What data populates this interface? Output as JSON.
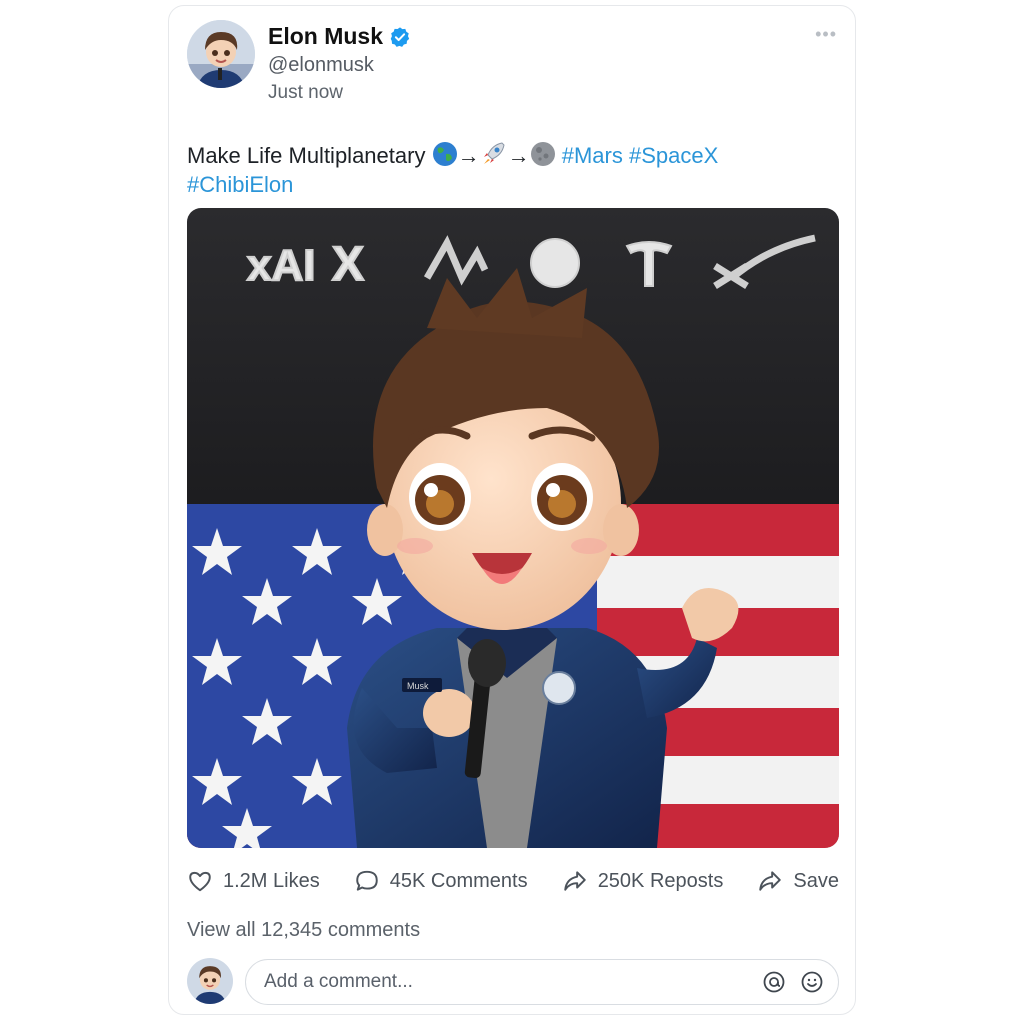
{
  "post": {
    "author": {
      "name": "Elon Musk",
      "handle": "@elonmusk",
      "verified": true,
      "avatar_icon": "chibi-avatar"
    },
    "timestamp": "Just now",
    "more_icon": "more-options-icon",
    "text": {
      "prefix": "Make Life Multiplanetary",
      "emoji_sequence": [
        "earth-emoji",
        "arrow",
        "rocket-emoji",
        "arrow",
        "moon-emoji"
      ],
      "arrow": "→",
      "hashtags": [
        "#Mars",
        "#SpaceX",
        "#ChibiElon"
      ]
    },
    "media": {
      "logos": [
        "xAI",
        "X",
        "Neuralink",
        "Boring",
        "Tesla",
        "SpaceX"
      ],
      "figure_badge": "Musk"
    },
    "actions": {
      "likes": "1.2M Likes",
      "comments": "45K Comments",
      "reposts": "250K Reposts",
      "save": "Save"
    },
    "view_all_comments": "View all 12,345 comments",
    "comment_input": {
      "placeholder": "Add a comment..."
    }
  },
  "colors": {
    "hashtag": "#2b95d8",
    "verified": "#1d9bf0",
    "text_muted": "#5d646c"
  }
}
